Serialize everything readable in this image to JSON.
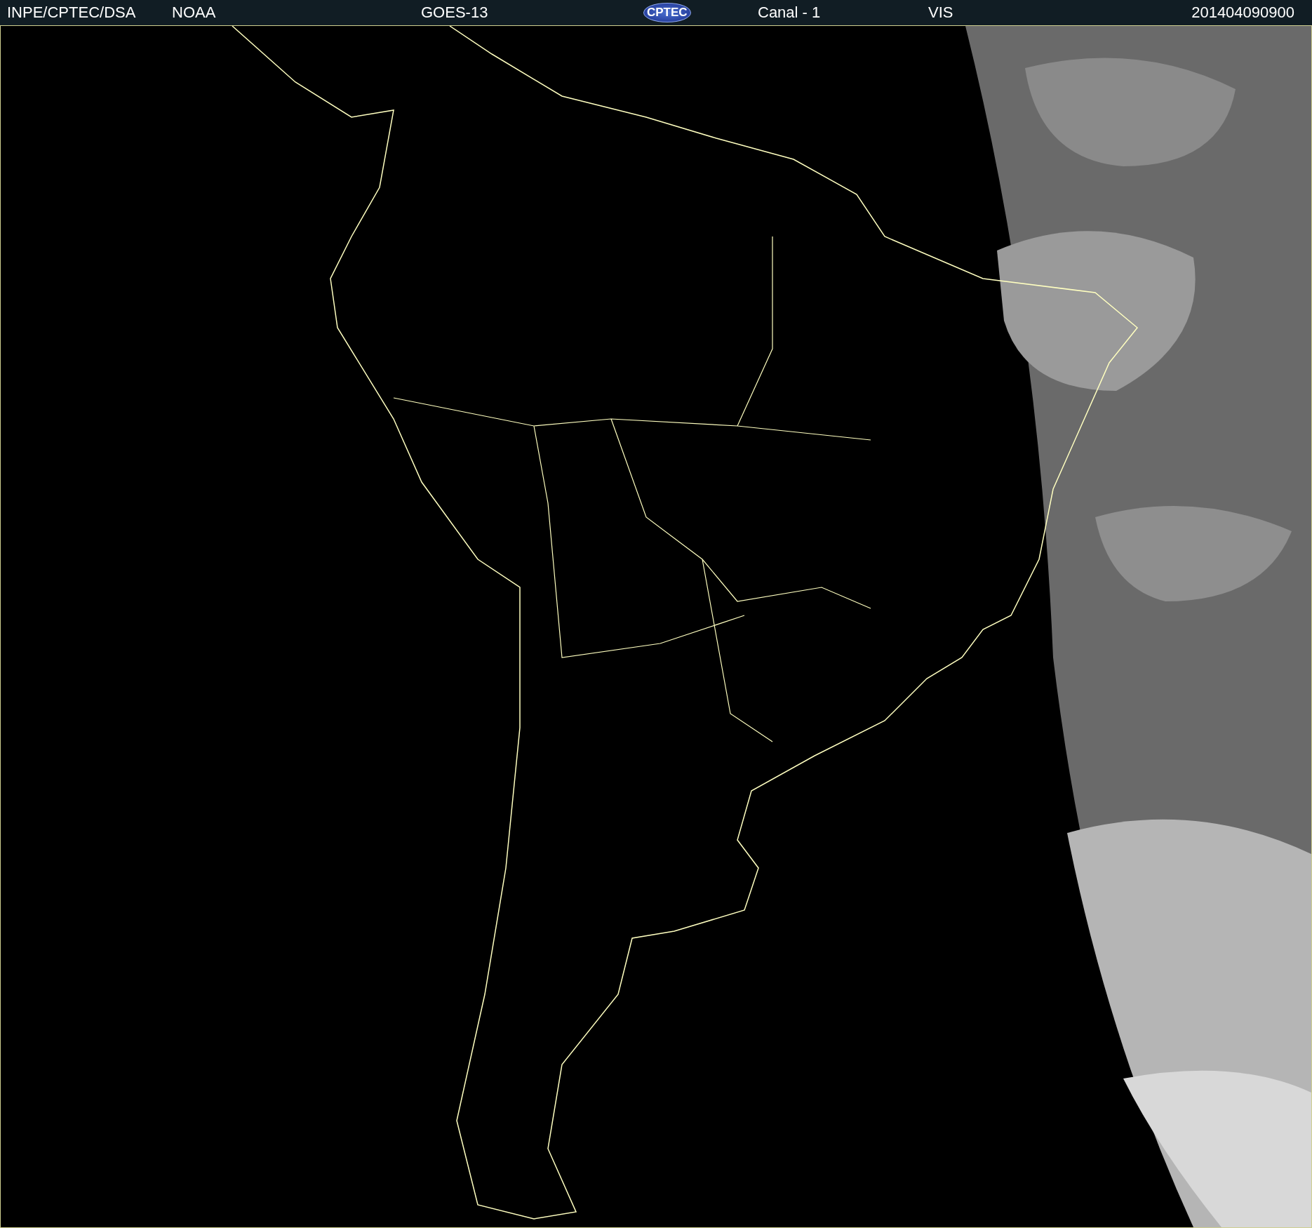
{
  "header": {
    "items": [
      {
        "kind": "text",
        "text": "INPE/CPTEC/DSA"
      },
      {
        "kind": "text",
        "text": "NOAA"
      },
      {
        "kind": "text",
        "text": "GOES-13"
      },
      {
        "kind": "logo",
        "text": "CPTEC"
      },
      {
        "kind": "text",
        "text": "Canal - 1"
      },
      {
        "kind": "text",
        "text": "VIS"
      },
      {
        "kind": "spacer"
      },
      {
        "kind": "text",
        "text": "201404090900"
      }
    ]
  }
}
